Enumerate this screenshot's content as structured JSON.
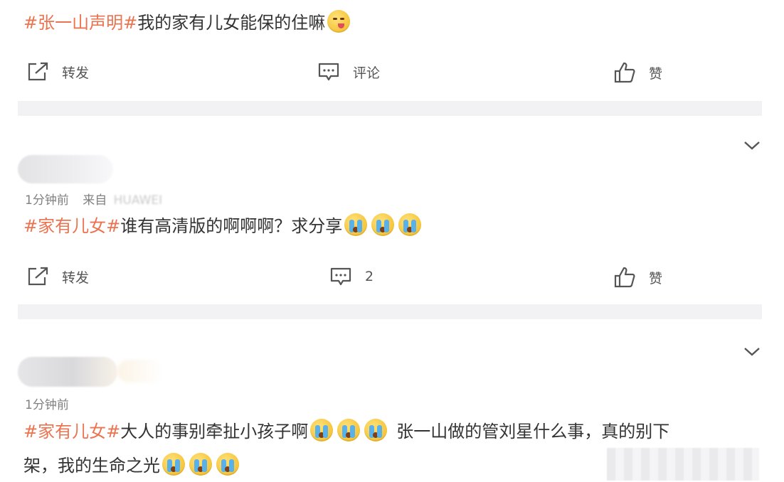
{
  "posts": [
    {
      "tag": "#张一山声明#",
      "text": "我的家有儿女能保的住嘛",
      "actions": {
        "repost": "转发",
        "comment": "评论",
        "like": "赞"
      }
    },
    {
      "time": "1分钟前",
      "source_prefix": "来自",
      "source": "HUAWEI",
      "tag": "#家有儿女#",
      "text": "谁有高清版的啊啊啊？求分享",
      "actions": {
        "repost": "转发",
        "comment": "2",
        "like": "赞"
      }
    },
    {
      "time": "1分钟前",
      "tag": "#家有儿女#",
      "text_part1": "大人的事别牵扯小孩子啊",
      "text_part2": "张一山做的管刘星什么事，真的别下",
      "text_line2": "架，我的生命之光"
    }
  ],
  "colors": {
    "tag": "#eb7350",
    "separator": "#f2f2f5",
    "meta": "#808080"
  },
  "icons": [
    "repost-icon",
    "comment-icon",
    "like-icon",
    "chevron-down-icon",
    "crying-emoji",
    "licking-emoji"
  ]
}
